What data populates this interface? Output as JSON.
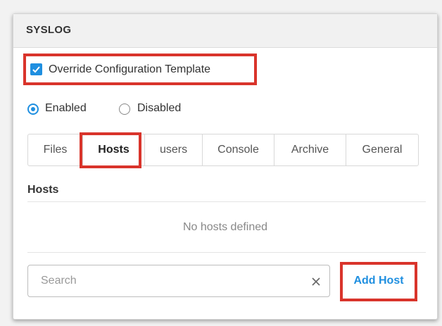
{
  "panel": {
    "title": "SYSLOG"
  },
  "override": {
    "label": "Override Configuration Template",
    "checked": true
  },
  "mode": {
    "enabled_label": "Enabled",
    "disabled_label": "Disabled",
    "selected": "Enabled"
  },
  "tabs": [
    {
      "label": "Files"
    },
    {
      "label": "Hosts"
    },
    {
      "label": "users"
    },
    {
      "label": "Console"
    },
    {
      "label": "Archive"
    },
    {
      "label": "General"
    }
  ],
  "active_tab": "Hosts",
  "hosts": {
    "title": "Hosts",
    "empty_message": "No hosts defined"
  },
  "search": {
    "placeholder": "Search"
  },
  "actions": {
    "add_host_label": "Add Host"
  },
  "colors": {
    "accent": "#1f8fe0",
    "highlight": "#d9342b"
  }
}
